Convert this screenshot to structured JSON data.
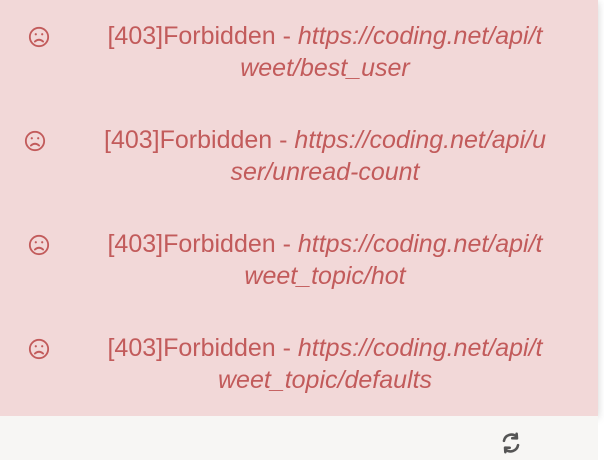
{
  "alerts": [
    {
      "icon": "frown-icon",
      "message": "[403]Forbidden - ",
      "url_line1": "https://coding.net/api/t",
      "url_line2": "weet/best_user"
    },
    {
      "icon": "frown-icon",
      "message": "[403]Forbidden - ",
      "url_line1": "https://coding.net/api/u",
      "url_line2": "ser/unread-count"
    },
    {
      "icon": "frown-icon",
      "message": "[403]Forbidden - ",
      "url_line1": "https://coding.net/api/t",
      "url_line2": "weet_topic/hot"
    },
    {
      "icon": "frown-icon",
      "message": "[403]Forbidden - ",
      "url_line1": "https://coding.net/api/t",
      "url_line2": "weet_topic/defaults"
    }
  ],
  "toolbar": {
    "refresh_icon": "refresh-icon"
  },
  "colors": {
    "alert_background": "#f2d8d8",
    "alert_text": "#c25b5b"
  }
}
